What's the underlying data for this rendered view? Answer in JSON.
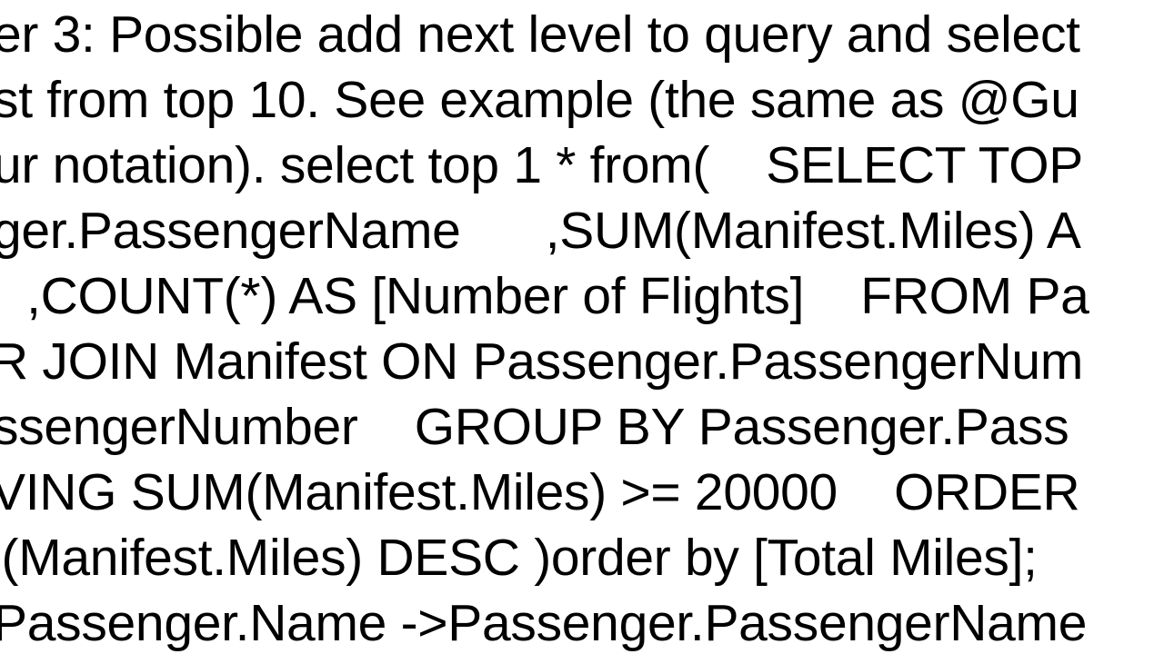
{
  "document": {
    "lines": [
      "er 3: Possible add next level to query and select",
      "st from top 10. See example (the same as @Gu",
      "ur notation). select top 1 * from(    SELECT TOP",
      "ger.PassengerName      ,SUM(Manifest.Miles) A",
      "  ,COUNT(*) AS [Number of Flights]    FROM Pa",
      "R JOIN Manifest ON Passenger.PassengerNum",
      "ssengerNumber    GROUP BY Passenger.Pass",
      "VING SUM(Manifest.Miles) >= 20000    ORDER",
      "I(Manifest.Miles) DESC )order by [Total Miles];",
      "Passenger.Name ->Passenger.PassengerName"
    ]
  }
}
